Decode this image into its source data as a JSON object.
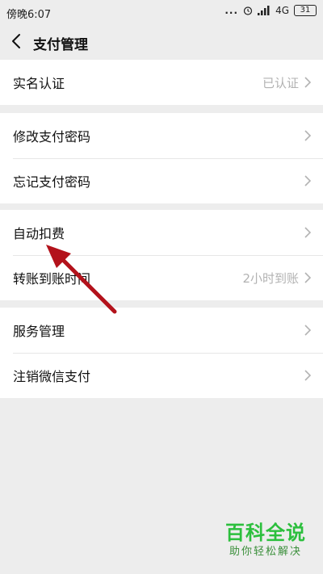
{
  "status_bar": {
    "time": "傍晚6:07",
    "dots": "...",
    "network": "4G",
    "battery": "31"
  },
  "nav": {
    "title": "支付管理"
  },
  "groups": [
    {
      "items": [
        {
          "label": "实名认证",
          "value": "已认证"
        }
      ]
    },
    {
      "items": [
        {
          "label": "修改支付密码",
          "value": ""
        },
        {
          "label": "忘记支付密码",
          "value": ""
        }
      ]
    },
    {
      "items": [
        {
          "label": "自动扣费",
          "value": ""
        },
        {
          "label": "转账到账时间",
          "value": "2小时到账"
        }
      ]
    },
    {
      "items": [
        {
          "label": "服务管理",
          "value": ""
        },
        {
          "label": "注销微信支付",
          "value": ""
        }
      ]
    }
  ],
  "annotation": {
    "arrow_color": "#b3121b"
  },
  "watermark": {
    "title": "百科全说",
    "subtitle": "助你轻松解决"
  }
}
